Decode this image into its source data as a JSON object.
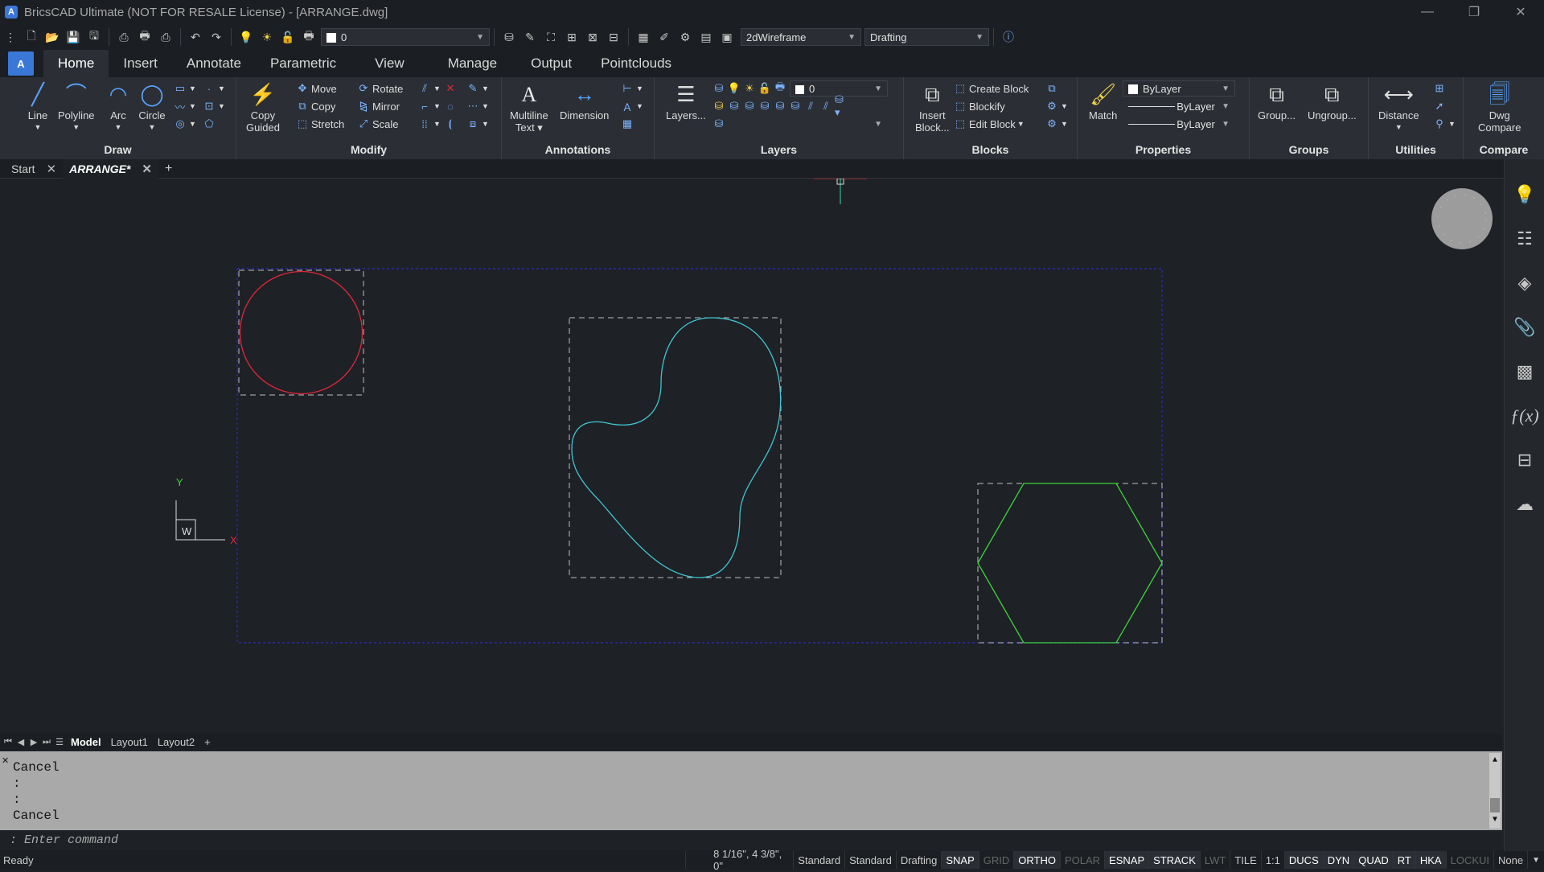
{
  "window": {
    "title": "BricsCAD Ultimate (NOT FOR RESALE License) - [ARRANGE.dwg]",
    "app_icon": "A"
  },
  "qat": {
    "layer_value": "0",
    "visual_style": "2dWireframe",
    "workspace": "Drafting"
  },
  "ribbon_tabs": [
    "Home",
    "Insert",
    "Annotate",
    "Parametric",
    "View",
    "Manage",
    "Output",
    "Pointclouds"
  ],
  "panels": {
    "draw": {
      "title": "Draw",
      "line": "Line",
      "polyline": "Polyline",
      "arc": "Arc",
      "circle": "Circle"
    },
    "modify": {
      "title": "Modify",
      "copy_guided_1": "Copy",
      "copy_guided_2": "Guided",
      "move": "Move",
      "copy": "Copy",
      "stretch": "Stretch",
      "rotate": "Rotate",
      "mirror": "Mirror",
      "scale": "Scale"
    },
    "annotations": {
      "title": "Annotations",
      "mtext_1": "Multiline",
      "mtext_2": "Text",
      "dimension": "Dimension"
    },
    "layers": {
      "title": "Layers",
      "layers_btn": "Layers...",
      "current_layer": "0"
    },
    "blocks": {
      "title": "Blocks",
      "insert_1": "Insert",
      "insert_2": "Block...",
      "create": "Create Block",
      "blockify": "Blockify",
      "edit": "Edit Block"
    },
    "properties": {
      "title": "Properties",
      "match": "Match",
      "color": "ByLayer",
      "linetype": "ByLayer",
      "lineweight": "ByLayer"
    },
    "groups": {
      "title": "Groups",
      "group": "Group...",
      "ungroup": "Ungroup..."
    },
    "utilities": {
      "title": "Utilities",
      "distance": "Distance"
    },
    "compare": {
      "title": "Compare",
      "dwg_1": "Dwg",
      "dwg_2": "Compare"
    }
  },
  "doc_tabs": {
    "start": "Start",
    "active": "ARRANGE*"
  },
  "ucs": {
    "y": "Y",
    "x": "X",
    "w": "W"
  },
  "layout_tabs": [
    "Model",
    "Layout1",
    "Layout2"
  ],
  "command_history": [
    "Cancel",
    ":",
    ":",
    "Cancel"
  ],
  "command_prompt": ": Enter command",
  "status": {
    "ready": "Ready",
    "coords": "8 1/16\", 4 3/8\", 0\"",
    "items": [
      {
        "label": "Standard",
        "state": "plain"
      },
      {
        "label": "Standard",
        "state": "plain"
      },
      {
        "label": "Drafting",
        "state": "plain"
      },
      {
        "label": "SNAP",
        "state": "on"
      },
      {
        "label": "GRID",
        "state": "off"
      },
      {
        "label": "ORTHO",
        "state": "on"
      },
      {
        "label": "POLAR",
        "state": "off"
      },
      {
        "label": "ESNAP",
        "state": "on"
      },
      {
        "label": "STRACK",
        "state": "on"
      },
      {
        "label": "LWT",
        "state": "off"
      },
      {
        "label": "TILE",
        "state": "plain"
      },
      {
        "label": "1:1",
        "state": "plain"
      },
      {
        "label": "DUCS",
        "state": "on"
      },
      {
        "label": "DYN",
        "state": "on"
      },
      {
        "label": "QUAD",
        "state": "on"
      },
      {
        "label": "RT",
        "state": "on"
      },
      {
        "label": "HKA",
        "state": "on"
      },
      {
        "label": "LOCKUI",
        "state": "off"
      },
      {
        "label": "None",
        "state": "plain"
      }
    ]
  },
  "colors": {
    "circle": "#e0263a",
    "blob": "#3fc6d2",
    "hexagon": "#3bd63b",
    "frame": "#2a2aa8",
    "accent": "#3a78d8"
  }
}
